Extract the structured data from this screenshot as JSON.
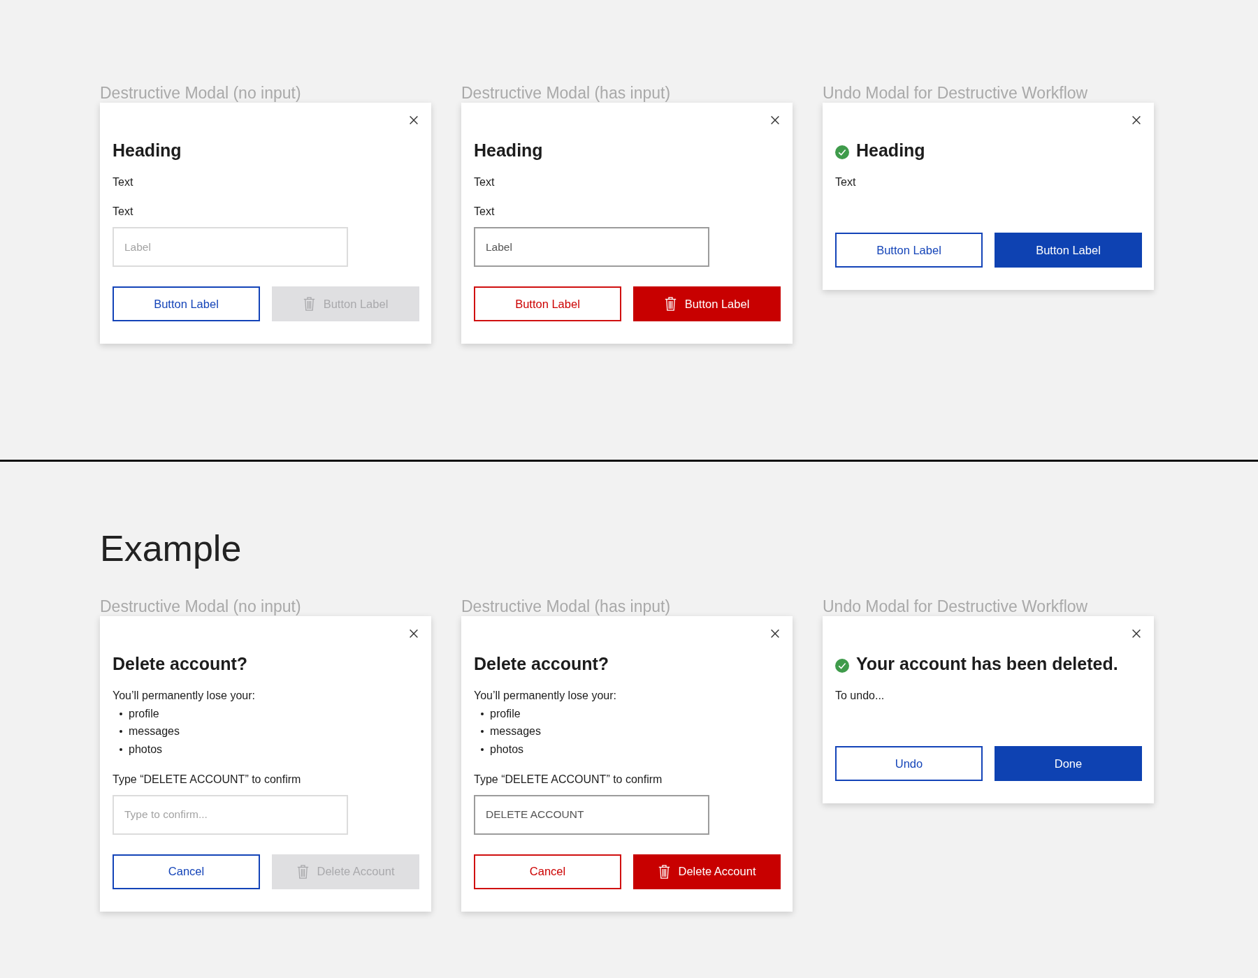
{
  "sections": [
    {
      "modals": [
        {
          "caption": "Destructive Modal (no input)",
          "success": false,
          "heading": "Heading",
          "body": [
            {
              "kind": "text",
              "text": "Text"
            },
            {
              "kind": "text",
              "text": "Text"
            }
          ],
          "input": {
            "placeholder": "Label"
          },
          "buttons": [
            {
              "label": "Button Label",
              "kind": "outline",
              "danger": false,
              "disabled": false
            },
            {
              "label": "Button Label",
              "kind": "filled",
              "danger": true,
              "disabled": true
            }
          ]
        },
        {
          "caption": "Destructive Modal (has input)",
          "success": false,
          "heading": "Heading",
          "body": [
            {
              "kind": "text",
              "text": "Text"
            },
            {
              "kind": "text",
              "text": "Text"
            }
          ],
          "input": {
            "value": "Label"
          },
          "buttons": [
            {
              "label": "Button Label",
              "kind": "outline",
              "danger": true,
              "disabled": false
            },
            {
              "label": "Button Label",
              "kind": "filled",
              "danger": true,
              "disabled": false
            }
          ]
        },
        {
          "caption": "Undo Modal for Destructive Workflow",
          "success": true,
          "heading": "Heading",
          "body": [
            {
              "kind": "text",
              "text": "Text"
            }
          ],
          "buttons": [
            {
              "label": "Button Label",
              "kind": "outline",
              "danger": false,
              "disabled": false
            },
            {
              "label": "Button Label",
              "kind": "filled",
              "danger": false,
              "disabled": false
            }
          ]
        }
      ]
    },
    {
      "title": "Example",
      "modals": [
        {
          "caption": "Destructive Modal (no input)",
          "success": false,
          "heading": "Delete account?",
          "body": [
            {
              "kind": "text",
              "text": "You’ll permanently lose your:"
            },
            {
              "kind": "list",
              "items": [
                "profile",
                "messages",
                "photos"
              ]
            },
            {
              "kind": "text",
              "text": "Type “DELETE ACCOUNT” to confirm"
            }
          ],
          "input": {
            "placeholder": "Type to confirm..."
          },
          "buttons": [
            {
              "label": "Cancel",
              "kind": "outline",
              "danger": false,
              "disabled": false
            },
            {
              "label": "Delete Account",
              "kind": "filled",
              "danger": true,
              "disabled": true
            }
          ]
        },
        {
          "caption": "Destructive Modal (has input)",
          "success": false,
          "heading": "Delete account?",
          "body": [
            {
              "kind": "text",
              "text": "You’ll permanently lose your:"
            },
            {
              "kind": "list",
              "items": [
                "profile",
                "messages",
                "photos"
              ]
            },
            {
              "kind": "text",
              "text": "Type “DELETE ACCOUNT” to confirm"
            }
          ],
          "input": {
            "value": "DELETE ACCOUNT"
          },
          "buttons": [
            {
              "label": "Cancel",
              "kind": "outline",
              "danger": true,
              "disabled": false
            },
            {
              "label": "Delete Account",
              "kind": "filled",
              "danger": true,
              "disabled": false
            }
          ]
        },
        {
          "caption": "Undo Modal for Destructive Workflow",
          "success": true,
          "heading": "Your account has been deleted.",
          "body": [
            {
              "kind": "text",
              "text": "To undo..."
            }
          ],
          "buttons": [
            {
              "label": "Undo",
              "kind": "outline",
              "danger": false,
              "disabled": false
            },
            {
              "label": "Done",
              "kind": "filled",
              "danger": false,
              "disabled": false
            }
          ]
        }
      ]
    }
  ]
}
